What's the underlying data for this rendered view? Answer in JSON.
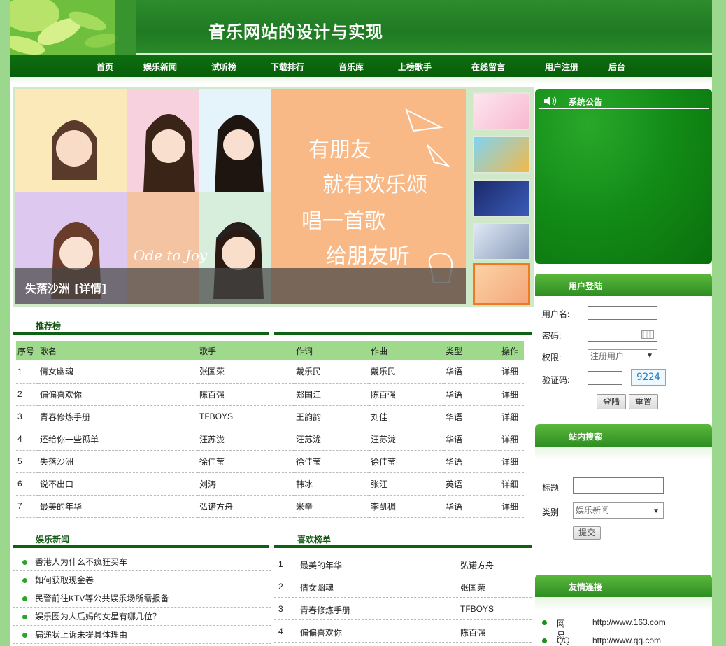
{
  "header": {
    "title": "音乐网站的设计与实现"
  },
  "nav": [
    "首页",
    "娱乐新闻",
    "试听榜",
    "下载排行",
    "音乐库",
    "上榜歌手",
    "在线留言",
    "用户注册",
    "后台"
  ],
  "banner": {
    "caption": "失落沙洲 [详情]",
    "art_text": [
      "有朋友",
      "就有欢乐颂",
      "唱一首歌",
      "给朋友听"
    ],
    "art_logo": "Ode to Joy"
  },
  "recommend": {
    "title": "推荐榜",
    "columns": [
      "序号",
      "歌名",
      "歌手",
      "作词",
      "作曲",
      "类型",
      "操作"
    ],
    "rows": [
      [
        "1",
        "倩女幽魂",
        "张国荣",
        "戴乐民",
        "戴乐民",
        "华语",
        "详细"
      ],
      [
        "2",
        "偏偏喜欢你",
        "陈百强",
        "郑国江",
        "陈百强",
        "华语",
        "详细"
      ],
      [
        "3",
        "青春修炼手册",
        "TFBOYS",
        "王韵韵",
        "刘佳",
        "华语",
        "详细"
      ],
      [
        "4",
        "还给你一些孤单",
        "汪苏泷",
        "汪苏泷",
        "汪苏泷",
        "华语",
        "详细"
      ],
      [
        "5",
        "失落沙洲",
        "徐佳莹",
        "徐佳莹",
        "徐佳莹",
        "华语",
        "详细"
      ],
      [
        "6",
        "说不出口",
        "刘涛",
        "韩冰",
        "张汪",
        "英语",
        "详细"
      ],
      [
        "7",
        "最美的年华",
        "弘诺方舟",
        "米辛",
        "李凯稠",
        "华语",
        "详细"
      ]
    ]
  },
  "news": {
    "title": "娱乐新闻",
    "items": [
      "香港人为什么不疯狂买车",
      "如何获取现金卷",
      "民警前往KTV等公共娱乐场所需报备",
      "娱乐圈为人后妈的女星有哪几位？",
      "扁递状上诉未提具体理由"
    ]
  },
  "favorites": {
    "title": "喜欢榜单",
    "items": [
      {
        "no": "1",
        "song": "最美的年华",
        "singer": "弘诺方舟"
      },
      {
        "no": "2",
        "song": "倩女幽魂",
        "singer": "张国荣"
      },
      {
        "no": "3",
        "song": "青春修炼手册",
        "singer": "TFBOYS"
      },
      {
        "no": "4",
        "song": "偏偏喜欢你",
        "singer": "陈百强"
      }
    ]
  },
  "notice": {
    "title": "系统公告"
  },
  "login": {
    "title": "用户登陆",
    "username_label": "用户名:",
    "password_label": "密码:",
    "role_label": "权限:",
    "role_value": "注册用户",
    "captcha_label": "验证码:",
    "captcha_code": "9224",
    "login_button": "登陆",
    "reset_button": "重置"
  },
  "search": {
    "title": "站内搜索",
    "title_label": "标题",
    "category_label": "类别",
    "category_value": "娱乐新闻",
    "submit_button": "提交"
  },
  "links": {
    "title": "友情连接",
    "items": [
      {
        "name": "网易",
        "url": "http://www.163.com"
      },
      {
        "name": "QQ",
        "url": "http://www.qq.com"
      }
    ]
  }
}
